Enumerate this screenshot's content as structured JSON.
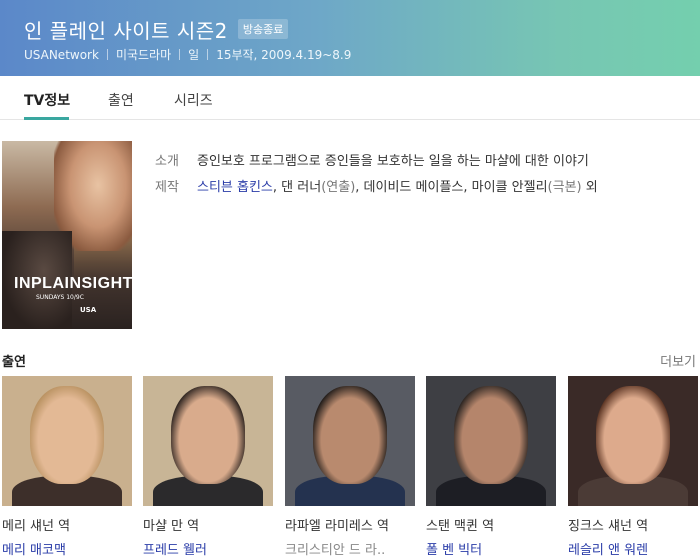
{
  "header": {
    "title": "인 플레인 사이트 시즌2",
    "status_badge": "방송종료",
    "meta": [
      "USANetwork",
      "미국드라마",
      "일",
      "15부작, 2009.4.19~8.9"
    ]
  },
  "tabs": [
    {
      "label": "TV정보",
      "active": true
    },
    {
      "label": "출연",
      "active": false
    },
    {
      "label": "시리즈",
      "active": false
    }
  ],
  "poster": {
    "title": "INPLAINSIGHT",
    "subtitle": "SUNDAYS 10/9C",
    "network": "USA"
  },
  "info": {
    "intro_label": "소개",
    "intro_text": "증인보호 프로그램으로 증인들을 보호하는 일을 하는 마샬에 대한 이야기",
    "staff_label": "제작",
    "staff": [
      {
        "name": "스티븐 홉킨스",
        "link": true,
        "suffix": ","
      },
      {
        "name": " 댄 러너",
        "link": false,
        "suffix": ""
      },
      {
        "name": "(연출)",
        "link": false,
        "muted": true,
        "suffix": ","
      },
      {
        "name": " 데이비드 메이플스, 마이클 안젤리",
        "link": false,
        "suffix": ""
      },
      {
        "name": "(극본)",
        "link": false,
        "muted": true,
        "suffix": ""
      },
      {
        "name": " 외",
        "link": false,
        "suffix": ""
      }
    ]
  },
  "cast": {
    "heading": "출연",
    "more_label": "더보기",
    "members": [
      {
        "role": "메리 섀넌 역",
        "actor": "메리 매코맥",
        "actor_link": true,
        "bg": "#c9b08e",
        "skin": "#e3b995",
        "hair": "#b89160",
        "clothes": "#3d2f2a"
      },
      {
        "role": "마샬 만 역",
        "actor": "프레드 웰러",
        "actor_link": true,
        "bg": "#c8b596",
        "skin": "#d9ab8c",
        "hair": "#2c231f",
        "clothes": "#2b2a2c"
      },
      {
        "role": "라파엘 라미레스 역",
        "actor": "크리스티안 드 라..",
        "actor_link": false,
        "bg": "#585b63",
        "skin": "#b98a6e",
        "hair": "#1e1a18",
        "clothes": "#24324f"
      },
      {
        "role": "스탠 맥퀸 역",
        "actor": "폴 벤 빅터",
        "actor_link": true,
        "bg": "#3e3f44",
        "skin": "#b5856b",
        "hair": "#2a2421",
        "clothes": "#1d1e24"
      },
      {
        "role": "징크스 섀넌 역",
        "actor": "레슬리 앤 워렌",
        "actor_link": true,
        "bg": "#3a2a27",
        "skin": "#ddaa8c",
        "hair": "#5a3322",
        "clothes": "#4b3b36"
      }
    ]
  }
}
